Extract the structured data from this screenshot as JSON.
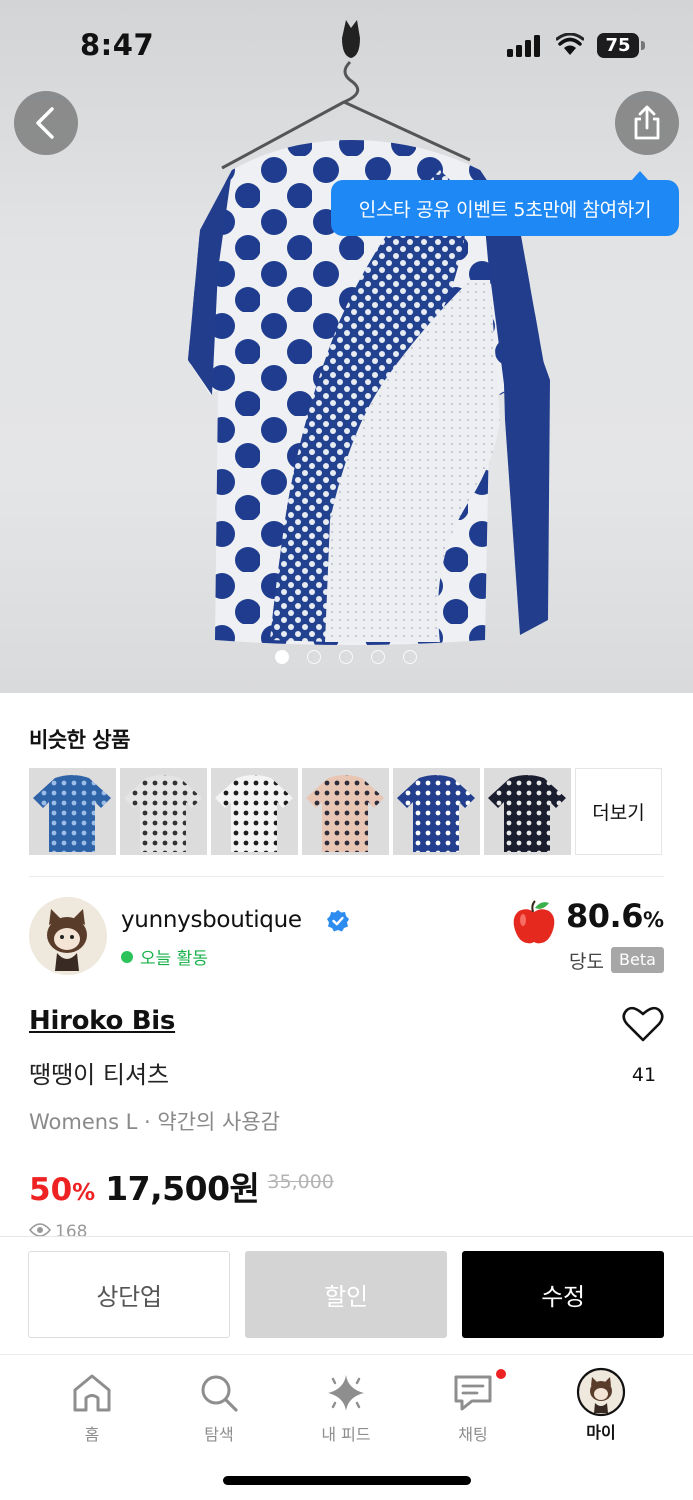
{
  "status_bar": {
    "time": "8:47",
    "battery": "75"
  },
  "hero": {
    "tooltip": "인스타 공유 이벤트 5초만에 참여하기",
    "image_count": 5,
    "current_image": 1,
    "icons": {
      "back": "chevron-left-icon",
      "share": "share-icon"
    }
  },
  "similar": {
    "title": "비슷한 상품",
    "more_label": "더보기",
    "items": [
      {
        "name": "similar-item-1",
        "bg": "#2f63a8",
        "fg": "#9bbde6"
      },
      {
        "name": "similar-item-2",
        "bg": "#e4e4e4",
        "fg": "#333333"
      },
      {
        "name": "similar-item-3",
        "bg": "#f4f4f4",
        "fg": "#1e1e1e"
      },
      {
        "name": "similar-item-4",
        "bg": "#e8c6b3",
        "fg": "#2c2c3c"
      },
      {
        "name": "similar-item-5",
        "bg": "#233f8e",
        "fg": "#ffffff"
      },
      {
        "name": "similar-item-6",
        "bg": "#1a1d2e",
        "fg": "#e8e8e8"
      }
    ]
  },
  "seller": {
    "name": "yunnysboutique",
    "activity": "오늘 활동",
    "score": "80.6",
    "score_unit": "%",
    "score_label": "당도",
    "beta": "Beta"
  },
  "product": {
    "brand": "Hiroko Bis",
    "title": "땡땡이 티셔츠",
    "meta": "Womens L · 약간의 사용감",
    "likes": "41",
    "discount": "50",
    "discount_unit": "%",
    "price": "17,500원",
    "original_price": "35,000",
    "views": "168"
  },
  "actions": {
    "bump": "상단업",
    "sale": "할인",
    "edit": "수정"
  },
  "tabs": [
    {
      "label": "홈",
      "icon": "home-icon"
    },
    {
      "label": "탐색",
      "icon": "search-icon"
    },
    {
      "label": "내 피드",
      "icon": "sparkle-icon"
    },
    {
      "label": "채팅",
      "icon": "chat-icon"
    },
    {
      "label": "마이",
      "icon": "avatar-icon"
    }
  ],
  "colors": {
    "accent_blue": "#1e88f5",
    "discount_red": "#ee2222",
    "active_green": "#19b24a"
  }
}
